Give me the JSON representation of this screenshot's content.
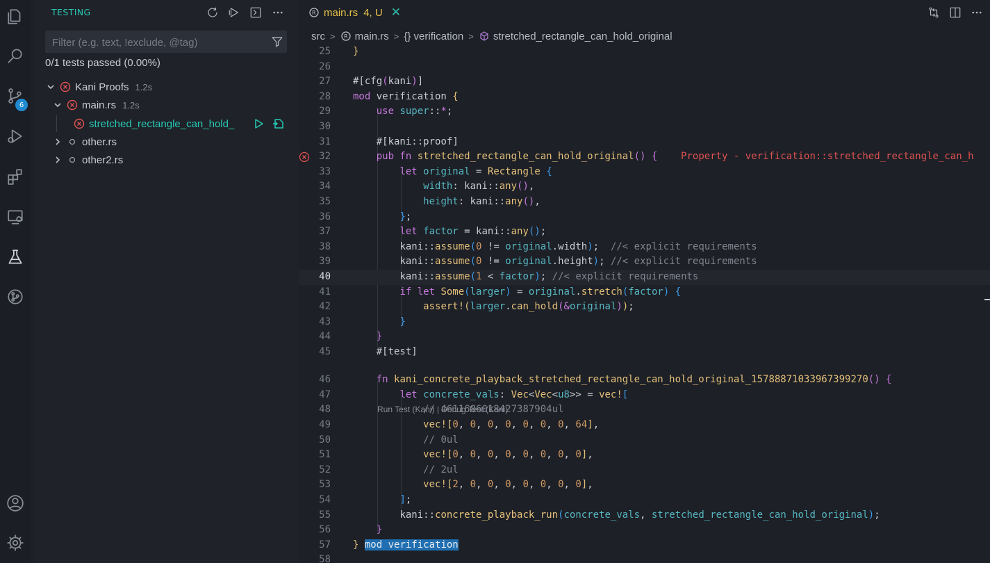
{
  "sidebar": {
    "title": "TESTING",
    "filter_placeholder": "Filter (e.g. text, !exclude, @tag)",
    "summary": "0/1 tests passed (0.00%)",
    "tree": [
      {
        "label": "Kani Proofs",
        "duration": "1.2s",
        "status": "failed",
        "expanded": true
      },
      {
        "label": "main.rs",
        "duration": "1.2s",
        "status": "failed",
        "expanded": true
      },
      {
        "label": "stretched_rectangle_can_hold_",
        "status": "failed",
        "active": true
      },
      {
        "label": "other.rs",
        "status": "not-run",
        "expanded": false
      },
      {
        "label": "other2.rs",
        "status": "not-run",
        "expanded": false
      }
    ]
  },
  "activity": {
    "scm_badge": "6"
  },
  "editor": {
    "tab": {
      "name": "main.rs",
      "status": "4, U",
      "close": "✕"
    },
    "breadcrumb": [
      "src",
      "main.rs",
      "{} verification",
      "stretched_rectangle_can_hold_original"
    ],
    "codelens": "Run Test (Kani) | Debug Test (Kani)",
    "line_numbers": [
      "25",
      "26",
      "27",
      "28",
      "29",
      "30",
      "31",
      "32",
      "33",
      "34",
      "35",
      "36",
      "37",
      "38",
      "39",
      "40",
      "41",
      "42",
      "43",
      "44",
      "45",
      "46",
      "47",
      "48",
      "49",
      "50",
      "51",
      "52",
      "53",
      "54",
      "55",
      "56",
      "57",
      "58"
    ],
    "current_line": "40",
    "error_message": "Property - verification::stretched_rectangle_can_h"
  },
  "colors": {
    "accent": "#27c9b5",
    "error": "#e05252",
    "tab_modified": "#e7c24a",
    "badge": "#1f8ad2"
  }
}
